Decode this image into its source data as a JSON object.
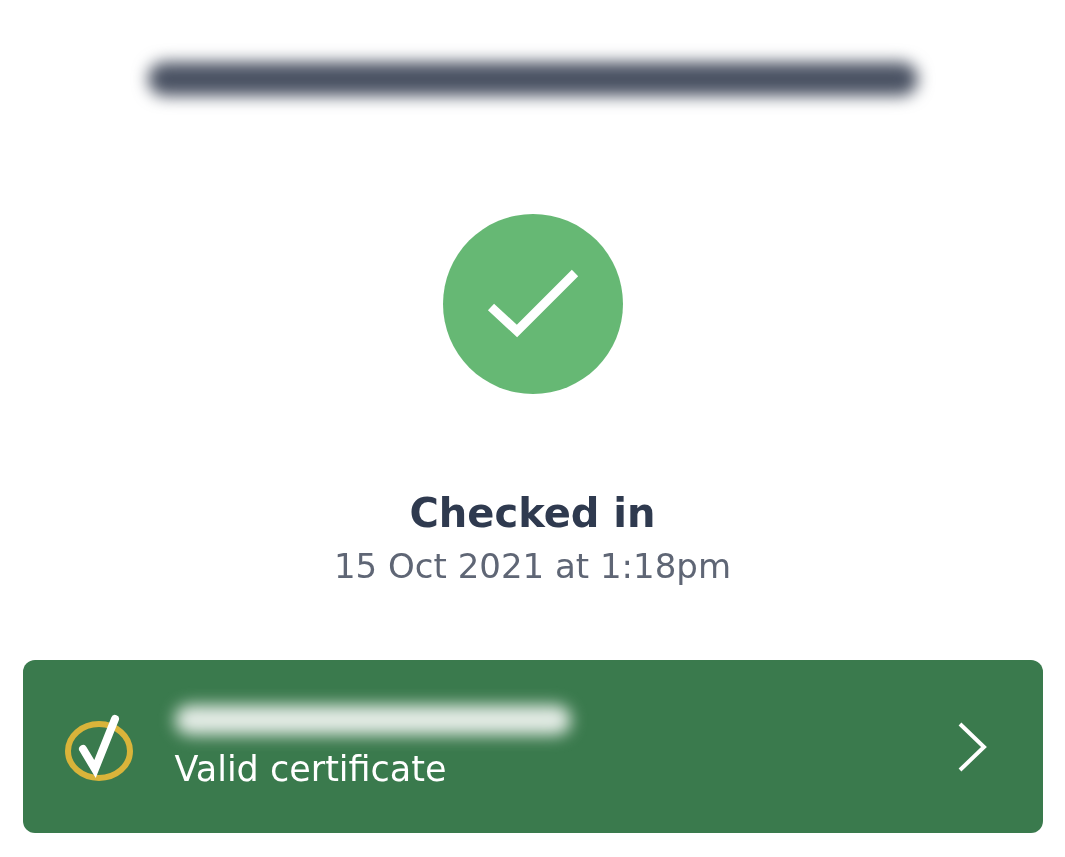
{
  "status": {
    "title": "Checked in",
    "time": "15 Oct 2021 at 1:18pm",
    "checked_in": true
  },
  "certificate": {
    "label": "Valid certificate",
    "valid": true
  }
}
